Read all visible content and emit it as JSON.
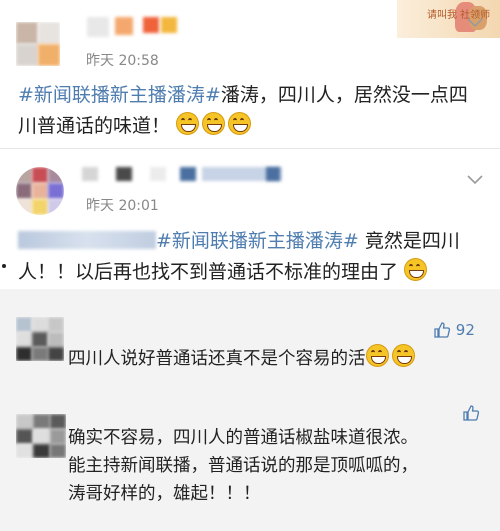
{
  "post1": {
    "time": "昨天 20:58",
    "topic": "#新闻联播新主播潘涛#",
    "text": "潘涛，四川人，居然没一点四川普通话的味道！",
    "badge": "请叫我 社领师"
  },
  "post2": {
    "time": "昨天 20:01",
    "topic": "#新闻联播新主播潘涛#",
    "text": "竟然是四川人！！以后再也找不到普通话不标准的理由了"
  },
  "comments": [
    {
      "text": "四川人说好普通话还真不是个容易的活",
      "likes": "92"
    },
    {
      "lines": [
        "确实不容易，四川人的普通话椒盐味道很浓。",
        "能主持新闻联播，普通话说的那是顶呱呱的，",
        "涛哥好样的，雄起！！！"
      ]
    }
  ],
  "colors": {
    "topic": "#4f7db0",
    "comment_bg": "#f3f3f3"
  }
}
